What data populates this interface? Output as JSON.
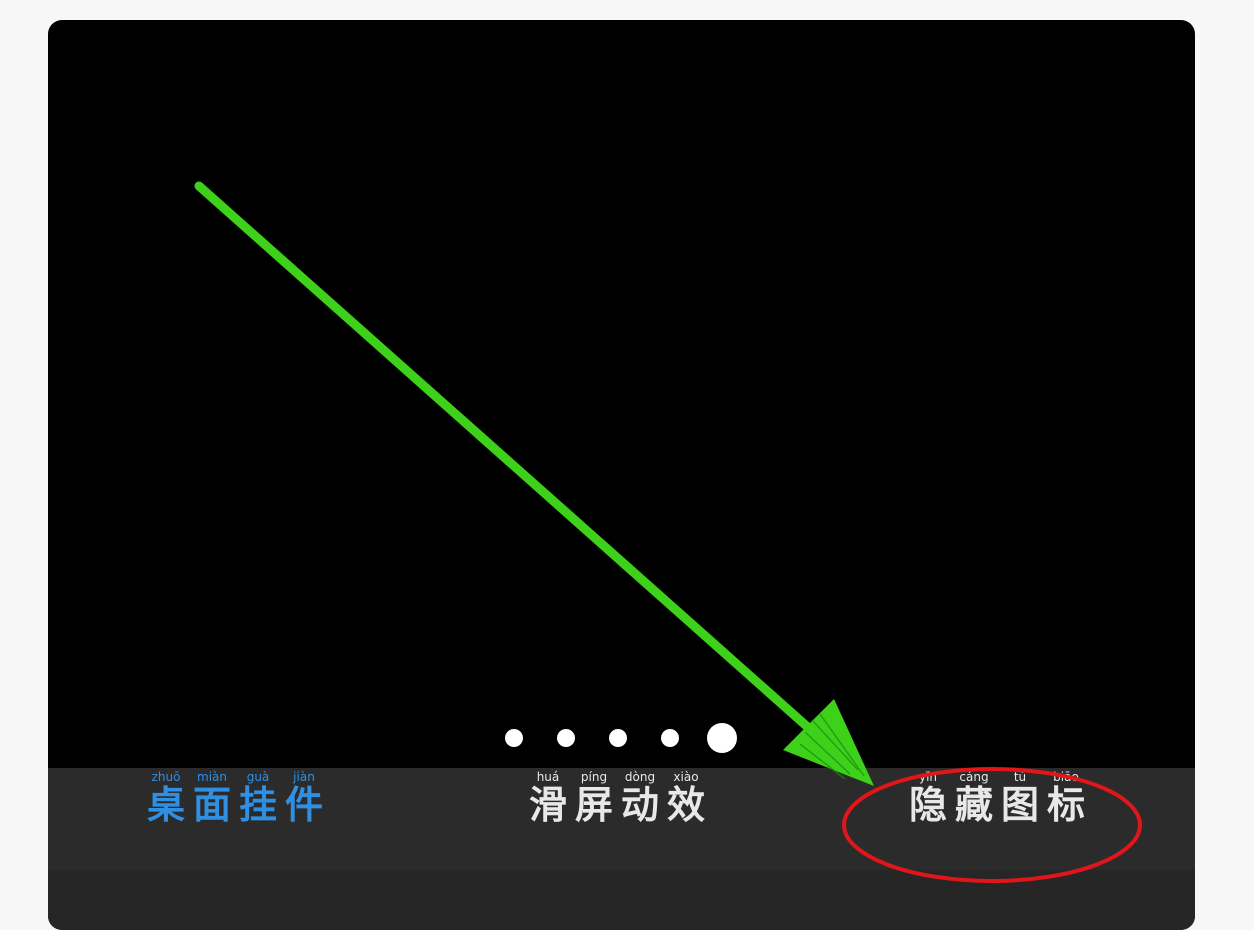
{
  "page_indicator": {
    "total_pages": 5,
    "current_page": 5
  },
  "menu": {
    "items": [
      {
        "key": "widgets",
        "chars": [
          {
            "pinyin": "zhuō",
            "hanzi": "桌"
          },
          {
            "pinyin": "miàn",
            "hanzi": "面"
          },
          {
            "pinyin": "guà",
            "hanzi": "挂"
          },
          {
            "pinyin": "jiàn",
            "hanzi": "件"
          }
        ],
        "color": "#2f8fe3",
        "selected": true
      },
      {
        "key": "scroll-effects",
        "chars": [
          {
            "pinyin": "huá",
            "hanzi": "滑"
          },
          {
            "pinyin": "píng",
            "hanzi": "屏"
          },
          {
            "pinyin": "dòng",
            "hanzi": "动"
          },
          {
            "pinyin": "xiào",
            "hanzi": "效"
          }
        ],
        "color": "#e8e8e8",
        "selected": false
      },
      {
        "key": "hide-icons",
        "chars": [
          {
            "pinyin": "yǐn",
            "hanzi": "隐"
          },
          {
            "pinyin": "cáng",
            "hanzi": "藏"
          },
          {
            "pinyin": "tú",
            "hanzi": "图"
          },
          {
            "pinyin": "biāo",
            "hanzi": "标"
          }
        ],
        "color": "#e8e8e8",
        "selected": false
      }
    ]
  },
  "annotations": {
    "arrow_color": "#3ed11a",
    "circle_color": "#e0161b"
  }
}
